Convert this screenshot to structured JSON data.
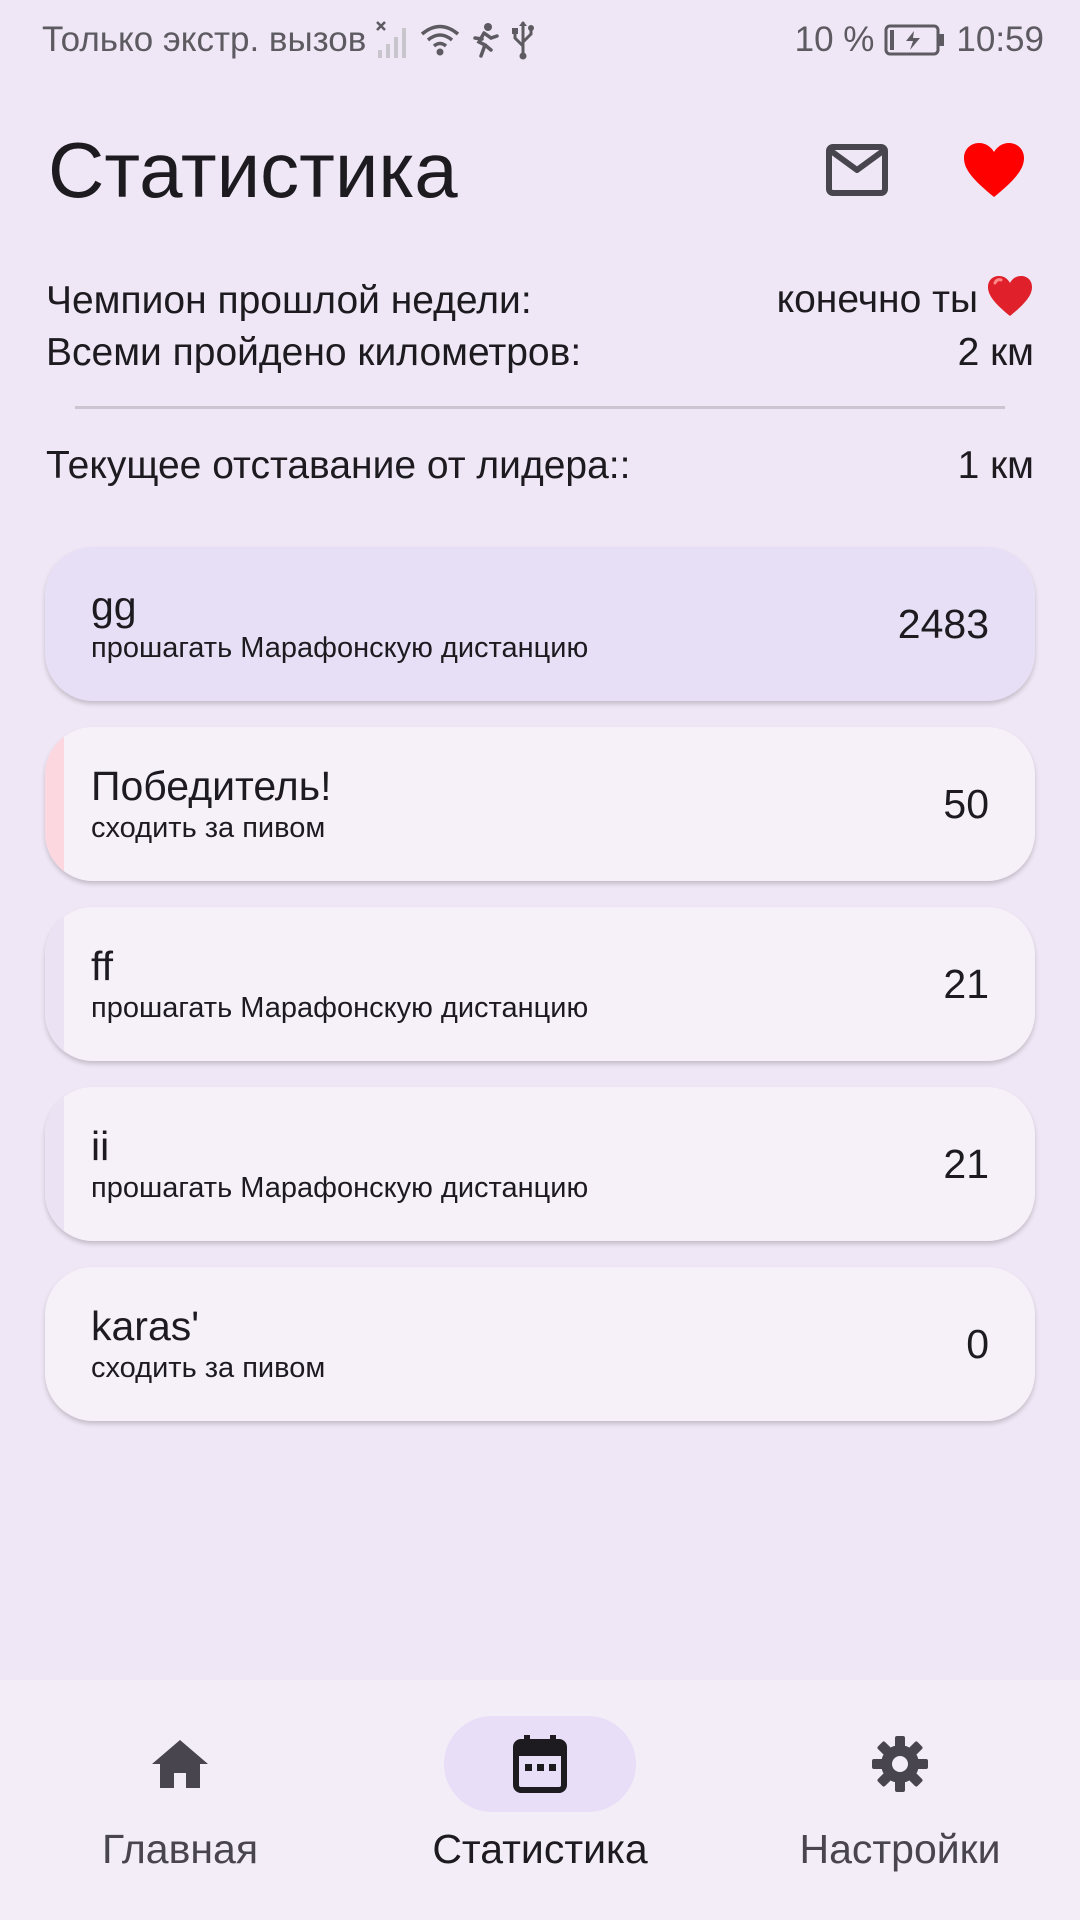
{
  "status_bar": {
    "carrier_text": "Только экстр. вызов",
    "battery_percent": "10 %",
    "time": "10:59",
    "icons": [
      "no-signal-icon",
      "wifi-icon",
      "running-icon",
      "usb-icon",
      "battery-charging-icon"
    ]
  },
  "header": {
    "title": "Статистика",
    "actions": [
      "mail-icon",
      "heart-icon"
    ]
  },
  "info": {
    "champion_label": "Чемпион прошлой недели:",
    "champion_value": "конечно ты",
    "total_label": "Всеми пройдено километров:",
    "total_value": "2 км",
    "lag_label": "Текущее отставание от лидера::",
    "lag_value": "1 км"
  },
  "leaderboard": [
    {
      "name": "gg",
      "goal": "прошагать Марафонскую дистанцию",
      "score": "2483"
    },
    {
      "name": "Победитель!",
      "goal": "сходить за пивом",
      "score": "50"
    },
    {
      "name": "ff",
      "goal": "прошагать Марафонскую дистанцию",
      "score": "21"
    },
    {
      "name": "ii",
      "goal": "прошагать Марафонскую дистанцию",
      "score": "21"
    },
    {
      "name": "karas'",
      "goal": "сходить за пивом",
      "score": "0"
    }
  ],
  "nav": {
    "items": [
      {
        "label": "Главная",
        "icon": "home-icon"
      },
      {
        "label": "Статистика",
        "icon": "calendar-icon",
        "active": true
      },
      {
        "label": "Настройки",
        "icon": "gear-icon"
      }
    ]
  },
  "colors": {
    "background": "#efe7f5",
    "card": "#f6f1f9",
    "card_highlight": "#e7dff5",
    "accent_red": "#fcd7e0",
    "nav_active": "#e8def8",
    "heart": "#ff0000"
  }
}
